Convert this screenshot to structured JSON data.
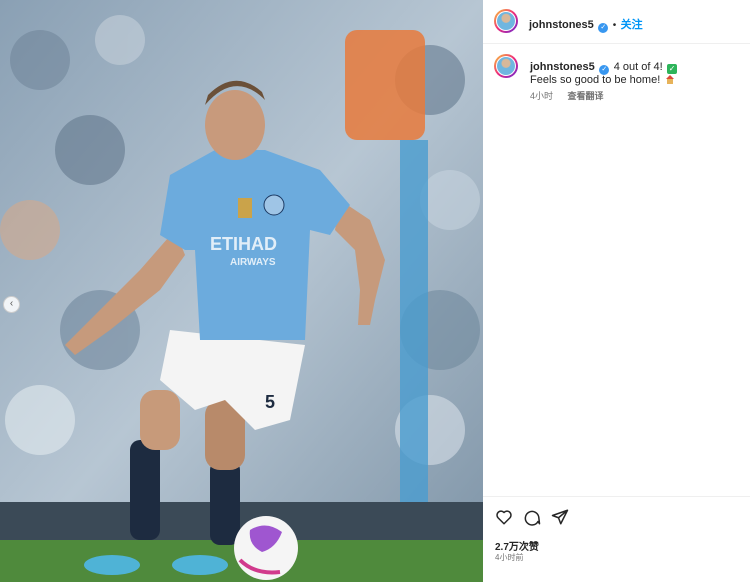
{
  "header": {
    "username": "johnstones5",
    "separator": "•",
    "follow_label": "关注"
  },
  "caption": {
    "username": "johnstones5",
    "text_line1": "4 out of 4!",
    "text_line2": "Feels so good to be home!",
    "time": "4小时",
    "translate_label": "查看翻译"
  },
  "footer": {
    "likes": "2.7万次赞",
    "time": "4小时前"
  },
  "photo": {
    "jersey_sponsor": "ETIHAD",
    "jersey_sponsor2": "AIRWAYS",
    "shirt_number": "5"
  },
  "icons": [
    "chevron-left-icon",
    "heart-icon",
    "comment-icon",
    "share-icon",
    "verified-icon",
    "check-emoji-icon",
    "house-emoji-icon"
  ],
  "colors": {
    "accent": "#0095f6",
    "verified": "#3897f0",
    "city_blue": "#6cabdd"
  }
}
